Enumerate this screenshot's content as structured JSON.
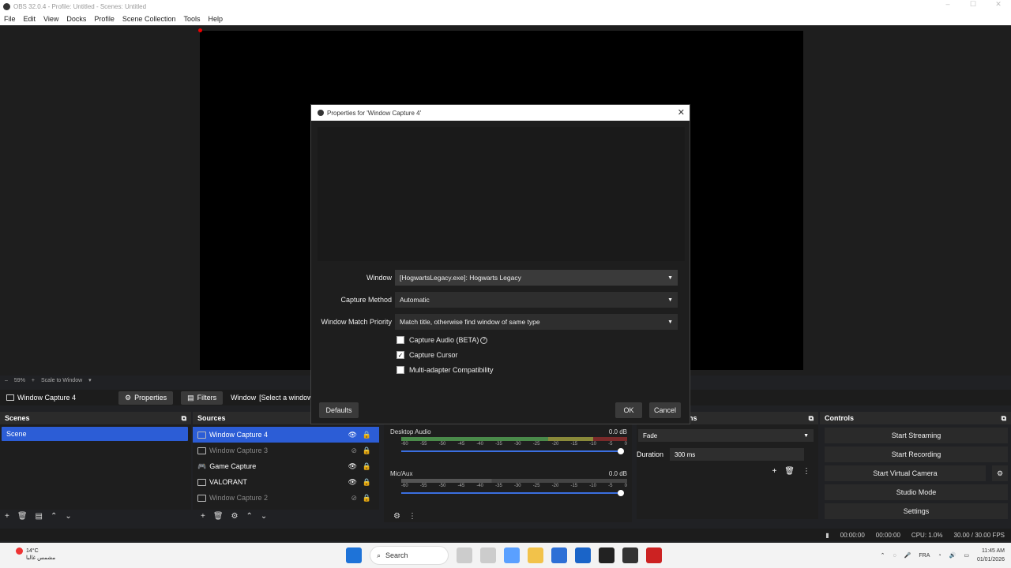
{
  "window": {
    "title": "OBS 32.0.4 - Profile: Untitled - Scenes: Untitled"
  },
  "menu": [
    "File",
    "Edit",
    "View",
    "Docks",
    "Profile",
    "Scene Collection",
    "Tools",
    "Help"
  ],
  "zoom": {
    "percent": "59%",
    "mode": "Scale to Window"
  },
  "source_bar": {
    "selected": "Window Capture 4",
    "properties": "Properties",
    "filters": "Filters",
    "window_label": "Window",
    "window_value": "[Select a window"
  },
  "scenes": {
    "title": "Scenes",
    "items": [
      "Scene"
    ]
  },
  "sources": {
    "title": "Sources",
    "items": [
      {
        "name": "Window Capture 4"
      },
      {
        "name": "Window Capture 3"
      },
      {
        "name": "Game Capture"
      },
      {
        "name": "VALORANT"
      },
      {
        "name": "Window Capture 2"
      }
    ]
  },
  "mixer": {
    "channels": [
      {
        "name": "Desktop Audio",
        "db": "0.0 dB"
      },
      {
        "name": "Mic/Aux",
        "db": "0.0 dB"
      }
    ],
    "ticks": [
      "-60",
      "-55",
      "-50",
      "-45",
      "-40",
      "-35",
      "-30",
      "-25",
      "-20",
      "-15",
      "-10",
      "-5",
      "0"
    ]
  },
  "transitions": {
    "title_partial": "ns",
    "type": "Fade",
    "duration_label": "Duration",
    "duration_value": "300 ms"
  },
  "controls": {
    "title": "Controls",
    "buttons": [
      "Start Streaming",
      "Start Recording",
      "Start Virtual Camera",
      "Studio Mode",
      "Settings"
    ]
  },
  "status": {
    "stream_time": "00:00:00",
    "rec_time": "00:00:00",
    "cpu": "CPU: 1.0%",
    "fps": "30.00 / 30.00 FPS"
  },
  "dialog": {
    "title": "Properties for 'Window Capture 4'",
    "fields": [
      {
        "label": "Window",
        "value": "[HogwartsLegacy.exe]: Hogwarts Legacy"
      },
      {
        "label": "Capture Method",
        "value": "Automatic"
      },
      {
        "label": "Window Match Priority",
        "value": "Match title, otherwise find window of same type"
      }
    ],
    "checks": [
      {
        "label": "Capture Audio (BETA)",
        "checked": false
      },
      {
        "label": "Capture Cursor",
        "checked": true
      },
      {
        "label": "Multi-adapter Compatibility",
        "checked": false
      }
    ],
    "defaults": "Defaults",
    "ok": "OK",
    "cancel": "Cancel"
  },
  "taskbar": {
    "temp": "14°C",
    "weather": "مشمس غالبا",
    "search": "Search",
    "lang": "FRA",
    "time": "11:45 AM",
    "date": "01/01/2026"
  }
}
